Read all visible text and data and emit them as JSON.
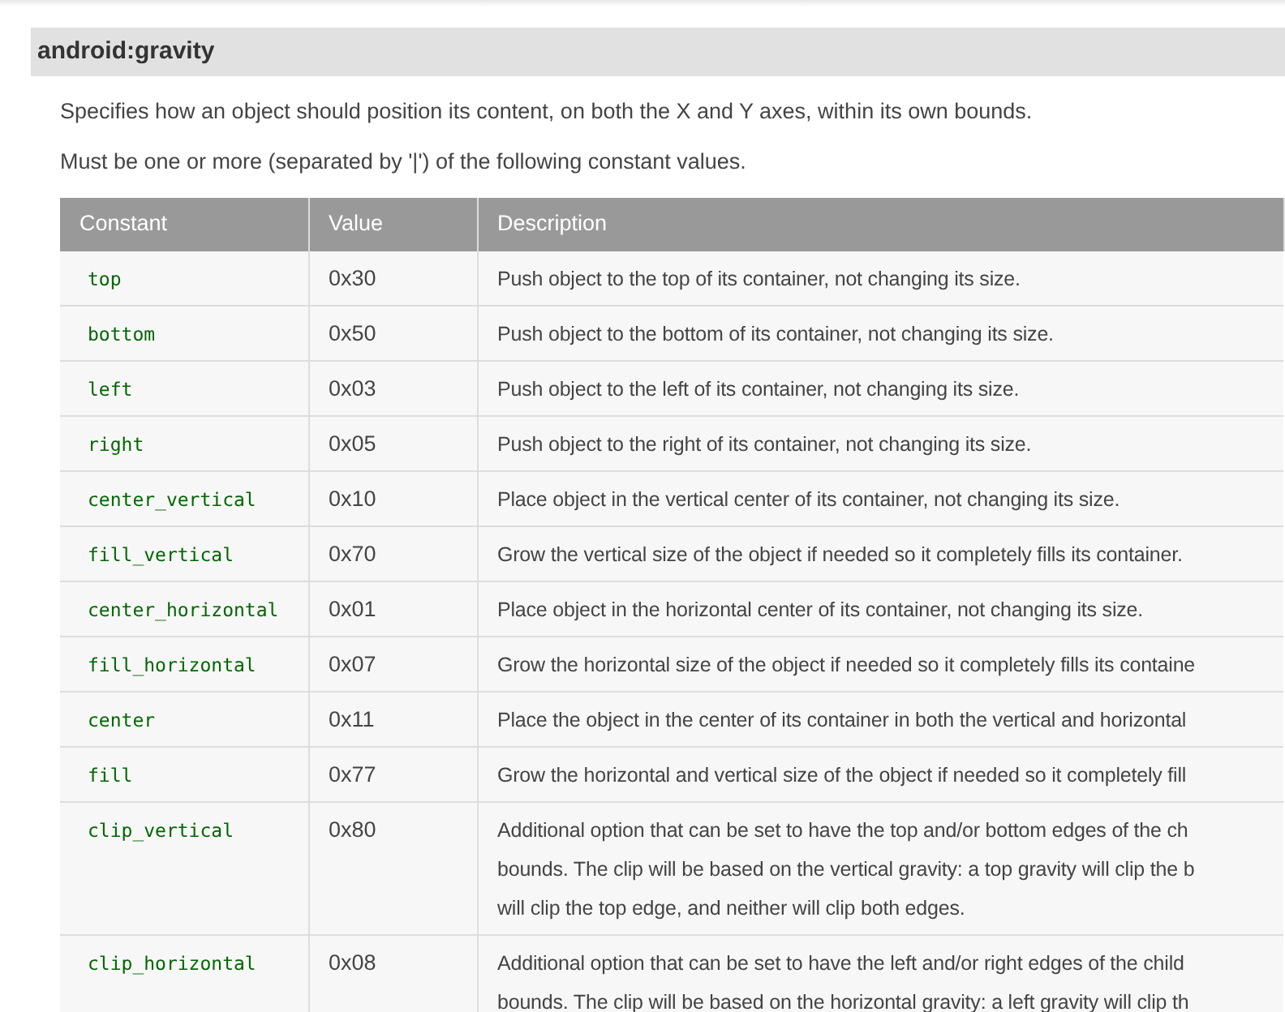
{
  "section": {
    "title": "android:gravity"
  },
  "paragraphs": [
    "Specifies how an object should position its content, on both the X and Y axes, within its own bounds.",
    "Must be one or more (separated by '|') of the following constant values."
  ],
  "table": {
    "columns": [
      "Constant",
      "Value",
      "Description"
    ],
    "rows": [
      {
        "constant": "top",
        "value": "0x30",
        "description": [
          "Push object to the top of its container, not changing its size."
        ]
      },
      {
        "constant": "bottom",
        "value": "0x50",
        "description": [
          "Push object to the bottom of its container, not changing its size."
        ]
      },
      {
        "constant": "left",
        "value": "0x03",
        "description": [
          "Push object to the left of its container, not changing its size."
        ]
      },
      {
        "constant": "right",
        "value": "0x05",
        "description": [
          "Push object to the right of its container, not changing its size."
        ]
      },
      {
        "constant": "center_vertical",
        "value": "0x10",
        "description": [
          "Place object in the vertical center of its container, not changing its size."
        ]
      },
      {
        "constant": "fill_vertical",
        "value": "0x70",
        "description": [
          "Grow the vertical size of the object if needed so it completely fills its container."
        ]
      },
      {
        "constant": "center_horizontal",
        "value": "0x01",
        "description": [
          "Place object in the horizontal center of its container, not changing its size."
        ]
      },
      {
        "constant": "fill_horizontal",
        "value": "0x07",
        "description": [
          "Grow the horizontal size of the object if needed so it completely fills its containe"
        ]
      },
      {
        "constant": "center",
        "value": "0x11",
        "description": [
          "Place the object in the center of its container in both the vertical and horizontal"
        ]
      },
      {
        "constant": "fill",
        "value": "0x77",
        "description": [
          "Grow the horizontal and vertical size of the object if needed so it completely fill"
        ]
      },
      {
        "constant": "clip_vertical",
        "value": "0x80",
        "description": [
          "Additional option that can be set to have the top and/or bottom edges of the ch",
          "bounds. The clip will be based on the vertical gravity: a top gravity will clip the b",
          "will clip the top edge, and neither will clip both edges."
        ]
      },
      {
        "constant": "clip_horizontal",
        "value": "0x08",
        "description": [
          "Additional option that can be set to have the left and/or right edges of the child",
          "bounds. The clip will be based on the horizontal gravity: a left gravity will clip th"
        ]
      }
    ]
  }
}
